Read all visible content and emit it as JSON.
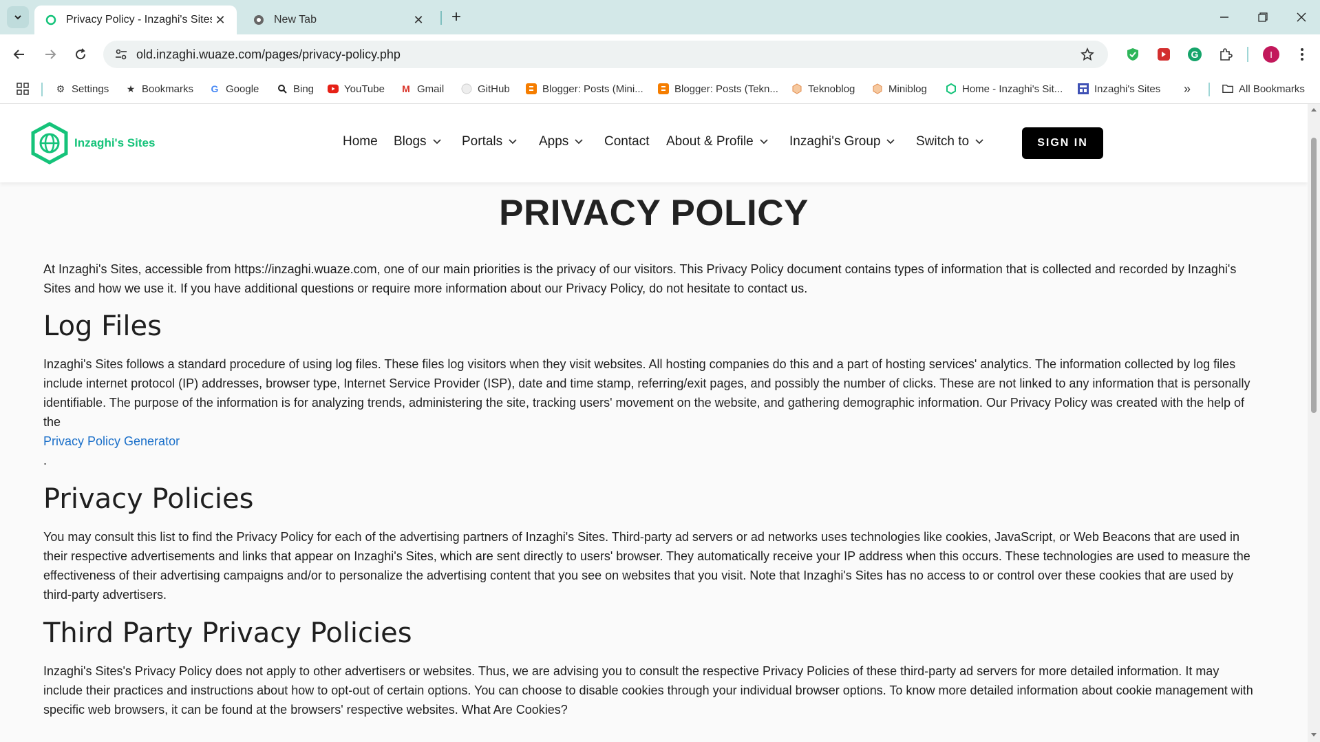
{
  "browser": {
    "tabs": [
      {
        "title": "Privacy Policy - Inzaghi's Sites",
        "active": true
      },
      {
        "title": "New Tab",
        "active": false
      }
    ],
    "url": "old.inzaghi.wuaze.com/pages/privacy-policy.php",
    "bookmarks": [
      {
        "label": "Settings",
        "icon": "gear-icon"
      },
      {
        "label": "Bookmarks",
        "icon": "star-icon"
      },
      {
        "label": "Google",
        "icon": "google-icon"
      },
      {
        "label": "Bing",
        "icon": "search-icon"
      },
      {
        "label": "YouTube",
        "icon": "youtube-icon"
      },
      {
        "label": "Gmail",
        "icon": "gmail-icon"
      },
      {
        "label": "GitHub",
        "icon": "github-icon"
      },
      {
        "label": "Blogger: Posts (Mini...",
        "icon": "blogger-icon"
      },
      {
        "label": "Blogger: Posts (Tekn...",
        "icon": "blogger-icon"
      },
      {
        "label": "Teknoblog",
        "icon": "hexagon-icon"
      },
      {
        "label": "Miniblog",
        "icon": "hexagon-icon"
      },
      {
        "label": "Home - Inzaghi's Sit...",
        "icon": "site-icon"
      },
      {
        "label": "Inzaghi's Sites",
        "icon": "grid-icon"
      }
    ],
    "all_bookmarks": "All Bookmarks",
    "profile_initial": "I"
  },
  "site": {
    "logo_text": "Inzaghi's Sites",
    "nav": {
      "home": "Home",
      "blogs": "Blogs",
      "portals": "Portals",
      "apps": "Apps",
      "contact": "Contact",
      "about": "About & Profile",
      "group": "Inzaghi's Group",
      "switch": "Switch to"
    },
    "signin": "SIGN IN"
  },
  "page": {
    "title": "PRIVACY POLICY",
    "intro": "At Inzaghi's Sites, accessible from https://inzaghi.wuaze.com, one of our main priorities is the privacy of our visitors. This Privacy Policy document contains types of information that is collected and recorded by Inzaghi's Sites and how we use it. If you have additional questions or require more information about our Privacy Policy, do not hesitate to contact us.",
    "log_files": {
      "heading": "Log Files",
      "text": "Inzaghi's Sites follows a standard procedure of using log files. These files log visitors when they visit websites. All hosting companies do this and a part of hosting services' analytics. The information collected by log files include internet protocol (IP) addresses, browser type, Internet Service Provider (ISP), date and time stamp, referring/exit pages, and possibly the number of clicks. These are not linked to any information that is personally identifiable. The purpose of the information is for analyzing trends, administering the site, tracking users' movement on the website, and gathering demographic information. Our Privacy Policy was created with the help of the",
      "link": "Privacy Policy Generator",
      "after": "."
    },
    "privacy_policies": {
      "heading": "Privacy Policies",
      "text": "You may consult this list to find the Privacy Policy for each of the advertising partners of Inzaghi's Sites. Third-party ad servers or ad networks uses technologies like cookies, JavaScript, or Web Beacons that are used in their respective advertisements and links that appear on Inzaghi's Sites, which are sent directly to users' browser. They automatically receive your IP address when this occurs. These technologies are used to measure the effectiveness of their advertising campaigns and/or to personalize the advertising content that you see on websites that you visit. Note that Inzaghi's Sites has no access to or control over these cookies that are used by third-party advertisers."
    },
    "third_party": {
      "heading": "Third Party Privacy Policies",
      "text": "Inzaghi's Sites's Privacy Policy does not apply to other advertisers or websites. Thus, we are advising you to consult the respective Privacy Policies of these third-party ad servers for more detailed information. It may include their practices and instructions about how to opt-out of certain options. You can choose to disable cookies through your individual browser options. To know more detailed information about cookie management with specific web browsers, it can be found at the browsers' respective websites. What Are Cookies?"
    }
  },
  "colors": {
    "brand": "#15c37a",
    "link": "#1a6fc9",
    "tabbar": "#d3e8e8"
  }
}
